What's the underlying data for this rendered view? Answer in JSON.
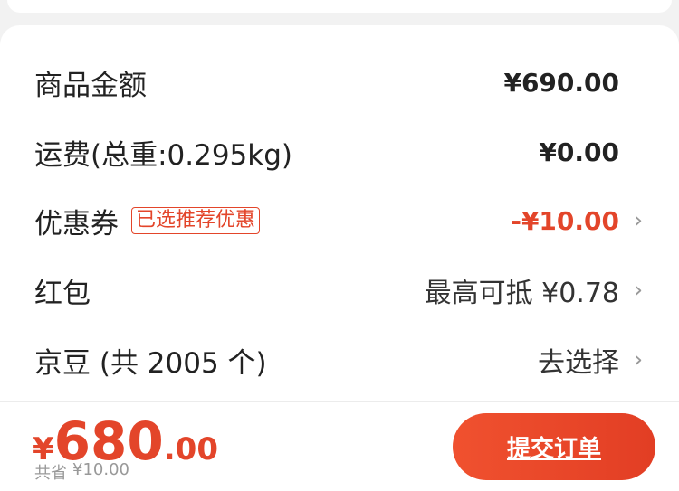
{
  "summary": {
    "goods_amount": {
      "label": "商品金额",
      "value": "¥690.00"
    },
    "shipping": {
      "label": "运费(总重:0.295kg)",
      "value": "¥0.00"
    },
    "coupon": {
      "label": "优惠券",
      "badge": "已选推荐优惠",
      "value": "-¥10.00"
    },
    "red_packet": {
      "label": "红包",
      "value": "最高可抵 ¥0.78"
    },
    "jd_beans": {
      "label": "京豆 (共 2005 个)",
      "value": "去选择"
    }
  },
  "footer": {
    "total_symbol": "¥",
    "total_integer": "680",
    "total_decimal": ".00",
    "saved_label": "共省",
    "saved_value": "¥10.00",
    "submit_label": "提交订单"
  },
  "colors": {
    "accent": "#e3452a",
    "text": "#222222",
    "muted": "#999999"
  }
}
